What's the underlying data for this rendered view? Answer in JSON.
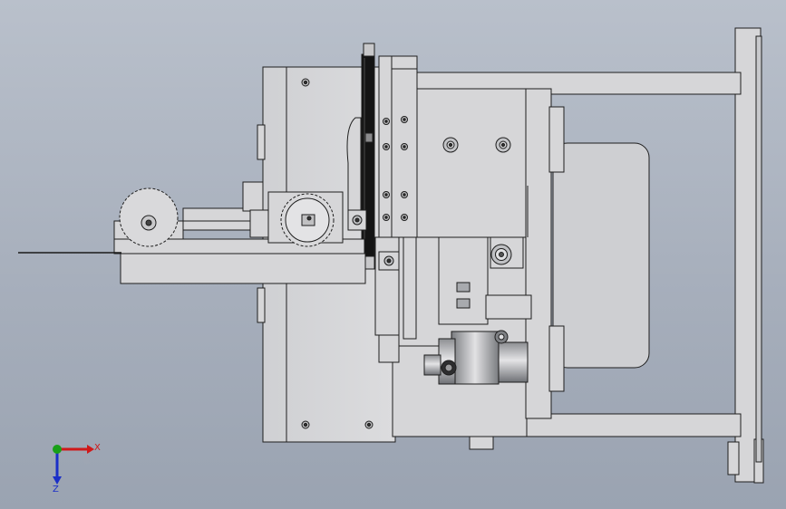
{
  "viewport": {
    "background_top": "#b9c0cb",
    "background_bottom": "#9aa3b1",
    "part_fill": "#d6d6d8",
    "part_shade": "#b4b6ba",
    "edge_color": "#1e1e1e",
    "belt_color": "#141414"
  },
  "triad": {
    "x_label": "X",
    "z_label": "Z",
    "x_color": "#d01818",
    "y_color": "#18a018",
    "z_color": "#1a2fc8"
  }
}
